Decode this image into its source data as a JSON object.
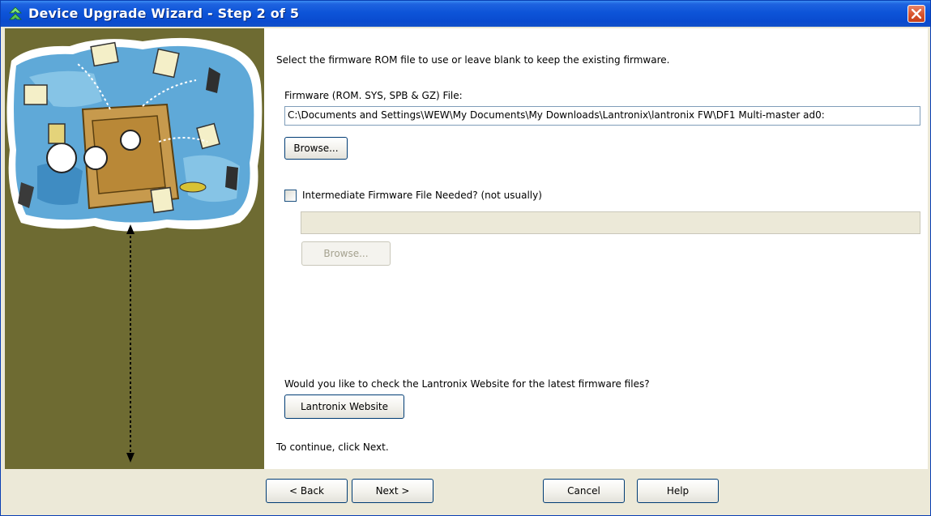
{
  "window": {
    "title": "Device Upgrade Wizard - Step 2 of 5",
    "icon": "lantronix-wizard-icon",
    "close_icon": "close-icon"
  },
  "colors": {
    "titlebar": "#0a4bcf",
    "left_panel": "#6e6b32",
    "close_button": "#d8532c"
  },
  "main": {
    "intro": "Select the firmware ROM file to use or leave blank to keep the existing firmware.",
    "firmware_label": "Firmware (ROM. SYS, SPB & GZ) File:",
    "firmware_path": "C:\\Documents and Settings\\WEW\\My Documents\\My Downloads\\Lantronix\\lantronix FW\\DF1 Multi-master ad0:",
    "browse_label": "Browse...",
    "intermediate_label": "Intermediate Firmware File Needed? (not usually)",
    "intermediate_checked": false,
    "intermediate_path": "",
    "intermediate_browse_label": "Browse...",
    "website_question": "Would you like to check the Lantronix Website for the latest firmware files?",
    "website_button": "Lantronix Website",
    "continue_text": "To continue, click Next."
  },
  "footer": {
    "back": "< Back",
    "next": "Next >",
    "cancel": "Cancel",
    "help": "Help"
  }
}
